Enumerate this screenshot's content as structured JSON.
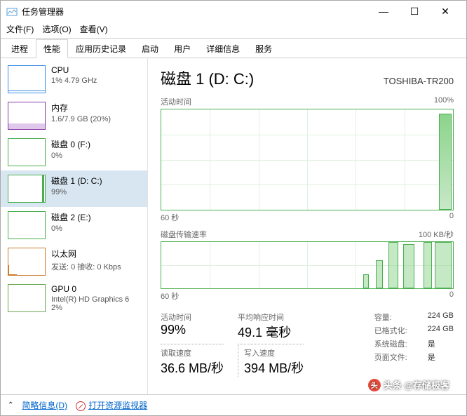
{
  "window": {
    "title": "任务管理器"
  },
  "menu": {
    "file": "文件(F)",
    "options": "选项(O)",
    "view": "查看(V)"
  },
  "tabs": [
    "进程",
    "性能",
    "应用历史记录",
    "启动",
    "用户",
    "详细信息",
    "服务"
  ],
  "active_tab": 1,
  "sidebar": [
    {
      "name": "CPU",
      "sub": "1% 4.79 GHz",
      "type": "cpu"
    },
    {
      "name": "内存",
      "sub": "1.6/7.9 GB (20%)",
      "type": "mem"
    },
    {
      "name": "磁盘 0 (F:)",
      "sub": "0%",
      "type": "disk"
    },
    {
      "name": "磁盘 1 (D: C:)",
      "sub": "99%",
      "type": "disk",
      "selected": true,
      "spike": true
    },
    {
      "name": "磁盘 2 (E:)",
      "sub": "0%",
      "type": "disk"
    },
    {
      "name": "以太网",
      "sub": "发送: 0 接收: 0 Kbps",
      "type": "net"
    },
    {
      "name": "GPU 0",
      "sub": "Intel(R) HD Graphics 6\n2%",
      "type": "gpu"
    }
  ],
  "main": {
    "title": "磁盘 1 (D: C:)",
    "device": "TOSHIBA-TR200",
    "chart1": {
      "label_left": "活动时间",
      "label_right": "100%",
      "x_left": "60 秒",
      "x_right": "0"
    },
    "chart2": {
      "label_left": "磁盘传输速率",
      "label_right": "100 KB/秒",
      "x_left": "60 秒",
      "x_right": "0"
    },
    "stats": {
      "active_label": "活动时间",
      "active_val": "99%",
      "resp_label": "平均响应时间",
      "resp_val": "49.1 毫秒",
      "read_label": "读取速度",
      "read_val": "36.6 MB/秒",
      "write_label": "写入速度",
      "write_val": "394 MB/秒"
    },
    "props": [
      {
        "lbl": "容量:",
        "val": "224 GB"
      },
      {
        "lbl": "已格式化:",
        "val": "224 GB"
      },
      {
        "lbl": "系统磁盘:",
        "val": "是"
      },
      {
        "lbl": "页面文件:",
        "val": "是"
      }
    ]
  },
  "status": {
    "brief": "简略信息(D)",
    "resmon": "打开资源监视器"
  },
  "watermark": "头条 @存储极客",
  "chart_data": [
    {
      "type": "line",
      "title": "活动时间",
      "xlabel": "60 秒 → 0",
      "ylabel": "%",
      "ylim": [
        0,
        100
      ],
      "x": [
        60,
        55,
        50,
        45,
        40,
        35,
        30,
        25,
        20,
        15,
        10,
        5,
        3,
        2,
        1,
        0
      ],
      "values": [
        0,
        0,
        0,
        0,
        0,
        0,
        0,
        0,
        0,
        0,
        0,
        0,
        0,
        5,
        99,
        95
      ]
    },
    {
      "type": "line",
      "title": "磁盘传输速率",
      "xlabel": "60 秒 → 0",
      "ylabel": "KB/秒",
      "ylim": [
        0,
        100
      ],
      "x": [
        60,
        50,
        40,
        30,
        25,
        22,
        20,
        18,
        16,
        14,
        12,
        10,
        8,
        6,
        4,
        2,
        0
      ],
      "values": [
        0,
        0,
        0,
        0,
        0,
        30,
        0,
        60,
        0,
        100,
        0,
        90,
        100,
        0,
        100,
        100,
        100
      ]
    }
  ]
}
